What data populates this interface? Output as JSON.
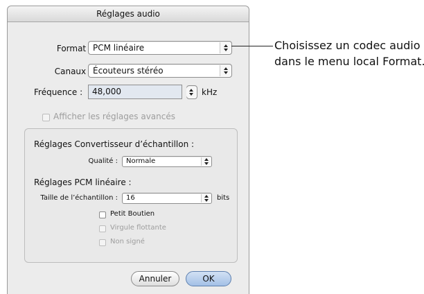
{
  "dialog": {
    "title": "Réglages audio",
    "format": {
      "label": "Format :",
      "value": "PCM linéaire"
    },
    "channels": {
      "label": "Canaux :",
      "value": "Écouteurs stéréo"
    },
    "frequency": {
      "label": "Fréquence :",
      "value": "48,000",
      "unit": "kHz"
    },
    "advanced_checkbox": {
      "label": "Afficher les réglages avancés",
      "checked": false,
      "enabled": false
    },
    "converter": {
      "heading": "Réglages Convertisseur d’échantillon :",
      "quality_label": "Qualité :",
      "quality_value": "Normale"
    },
    "pcm": {
      "heading": "Réglages PCM linéaire :",
      "sample_size_label": "Taille de l’échantillon :",
      "sample_size_value": "16",
      "sample_size_unit": "bits",
      "options": [
        {
          "label": "Petit Boutien",
          "checked": false,
          "enabled": true
        },
        {
          "label": "Virgule flottante",
          "checked": false,
          "enabled": false
        },
        {
          "label": "Non signé",
          "checked": false,
          "enabled": false
        }
      ]
    },
    "buttons": {
      "cancel": "Annuler",
      "ok": "OK"
    }
  },
  "callout": {
    "line1": "Choisissez un codec audio",
    "line2": "dans le menu local Format."
  }
}
